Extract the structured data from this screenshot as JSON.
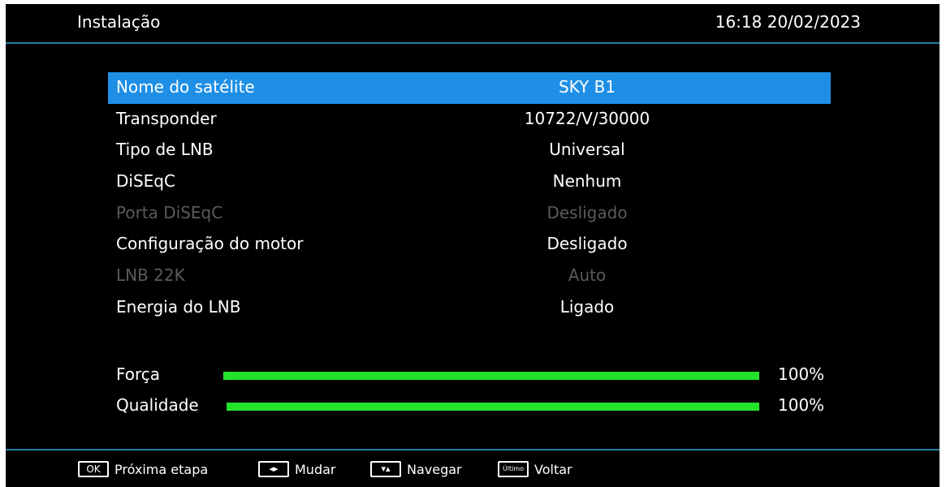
{
  "header": {
    "title": "Instalação",
    "clock": "16:18  20/02/2023"
  },
  "menu": {
    "items": [
      {
        "label": "Nome do satélite",
        "value": "SKY B1",
        "state": "selected"
      },
      {
        "label": "Transponder",
        "value": "10722/V/30000",
        "state": "normal"
      },
      {
        "label": "Tipo de LNB",
        "value": "Universal",
        "state": "normal"
      },
      {
        "label": "DiSEqC",
        "value": "Nenhum",
        "state": "normal"
      },
      {
        "label": "Porta DiSEqC",
        "value": "Desligado",
        "state": "disabled"
      },
      {
        "label": "Configuração do motor",
        "value": "Desligado",
        "state": "normal"
      },
      {
        "label": "LNB 22K",
        "value": "Auto",
        "state": "disabled"
      },
      {
        "label": "Energia do LNB",
        "value": "Ligado",
        "state": "normal"
      }
    ]
  },
  "signal": {
    "strength": {
      "label": "Força",
      "percent_text": "100%",
      "level": 1.0
    },
    "quality": {
      "label": "Qualidade",
      "percent_text": "100%",
      "level": 1.0
    }
  },
  "footer": {
    "hints": [
      {
        "key": "OK",
        "key_icon": "ok-key-icon",
        "label": "Próxima etapa"
      },
      {
        "key": "◂▸",
        "key_icon": "left-right-arrows-icon",
        "label": "Mudar"
      },
      {
        "key": "▾▴",
        "key_icon": "up-down-arrows-icon",
        "label": "Navegar"
      },
      {
        "key": "Último",
        "key_icon": "back-key-icon",
        "label": "Voltar"
      }
    ]
  },
  "colors": {
    "selected_row": "#1f8fe6",
    "bar_fill": "#22e32a",
    "divider": "#2a7fa3",
    "disabled_text": "#5a5a5a"
  }
}
